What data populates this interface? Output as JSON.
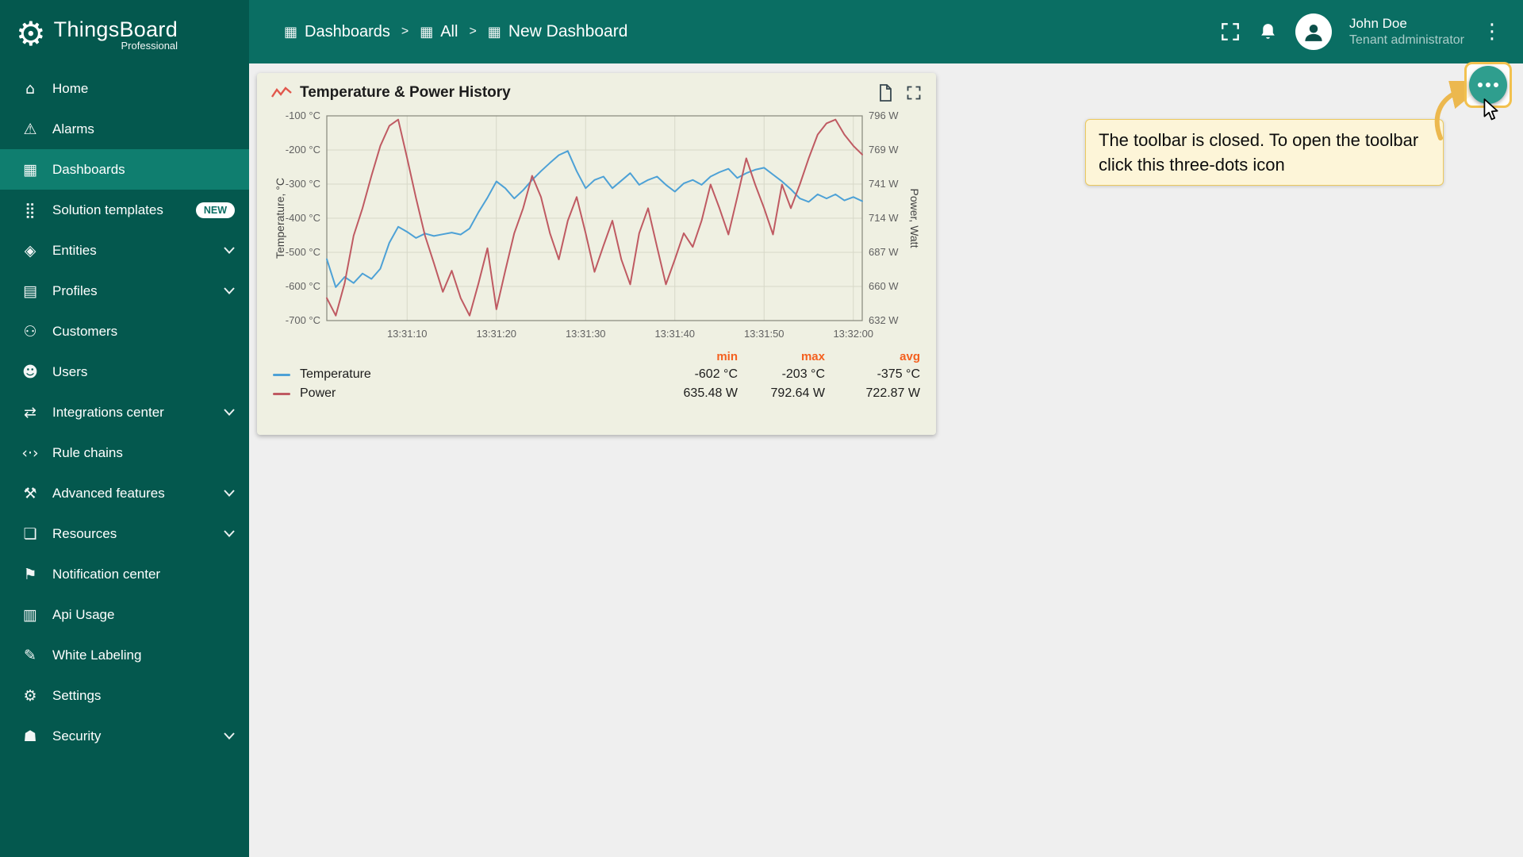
{
  "app": {
    "name": "ThingsBoard",
    "subtitle": "Professional",
    "logo_icon": "⛭"
  },
  "icons": {
    "kebab": "⋮",
    "logo_gear": "⚙"
  },
  "sidebar": {
    "items": [
      {
        "label": "Home",
        "icon": "⌂"
      },
      {
        "label": "Alarms",
        "icon": "⚠"
      },
      {
        "label": "Dashboards",
        "icon": "▦",
        "active": true
      },
      {
        "label": "Solution templates",
        "icon": "⣿",
        "badge": "NEW"
      },
      {
        "label": "Entities",
        "icon": "◈",
        "chevron": true
      },
      {
        "label": "Profiles",
        "icon": "▤",
        "chevron": true
      },
      {
        "label": "Customers",
        "icon": "⚇"
      },
      {
        "label": "Users",
        "icon": "☻"
      },
      {
        "label": "Integrations center",
        "icon": "⇄",
        "chevron": true
      },
      {
        "label": "Rule chains",
        "icon": "‹·›"
      },
      {
        "label": "Advanced features",
        "icon": "⚒",
        "chevron": true
      },
      {
        "label": "Resources",
        "icon": "❏",
        "chevron": true
      },
      {
        "label": "Notification center",
        "icon": "⚑"
      },
      {
        "label": "Api Usage",
        "icon": "▥"
      },
      {
        "label": "White Labeling",
        "icon": "✎"
      },
      {
        "label": "Settings",
        "icon": "⚙"
      },
      {
        "label": "Security",
        "icon": "☗",
        "chevron": true
      }
    ]
  },
  "header": {
    "separator": ">",
    "breadcrumb": [
      {
        "label": "Dashboards",
        "icon": "▦"
      },
      {
        "label": "All",
        "icon": "▦"
      },
      {
        "label": "New Dashboard",
        "icon": "▦"
      }
    ],
    "user": {
      "name": "John Doe",
      "role": "Tenant administrator"
    }
  },
  "widget": {
    "title": "Temperature & Power History",
    "legend": {
      "headers": [
        "min",
        "max",
        "avg"
      ],
      "rows": [
        {
          "label": "Temperature",
          "color": "#4da1d6",
          "min": "-602 °C",
          "max": "-203 °C",
          "avg": "-375 °C"
        },
        {
          "label": "Power",
          "color": "#bf5a62",
          "min": "635.48 W",
          "max": "792.64 W",
          "avg": "722.87 W"
        }
      ]
    }
  },
  "callout": {
    "text": "The toolbar is closed. To open the toolbar click this three-dots icon"
  },
  "colors": {
    "teal_header": "#0a6e63",
    "teal_sidebar": "#04584e",
    "teal_active": "#0f7e6f",
    "fab": "#2f9e8e",
    "highlight": "#f2c14e",
    "legend_header": "#f4601f",
    "card_bg": "#eff0e2"
  },
  "chart_data": {
    "type": "line",
    "title": "Temperature & Power History",
    "x_domain": [
      1,
      61
    ],
    "x_ticks": [
      {
        "t": 10,
        "label": "13:31:10"
      },
      {
        "t": 20,
        "label": "13:31:20"
      },
      {
        "t": 30,
        "label": "13:31:30"
      },
      {
        "t": 40,
        "label": "13:31:40"
      },
      {
        "t": 50,
        "label": "13:31:50"
      },
      {
        "t": 60,
        "label": "13:32:00"
      }
    ],
    "y_left": {
      "label": "Temperature, °C",
      "range": [
        -100,
        -700
      ],
      "ticks": [
        "-100 °C",
        "-200 °C",
        "-300 °C",
        "-400 °C",
        "-500 °C",
        "-600 °C",
        "-700 °C"
      ]
    },
    "y_right": {
      "label": "Power, Watt",
      "range": [
        796,
        632
      ],
      "ticks": [
        "796 W",
        "769 W",
        "741 W",
        "714 W",
        "687 W",
        "660 W",
        "632 W"
      ]
    },
    "legend_position": "bottom",
    "grid": true,
    "series": [
      {
        "name": "Temperature",
        "axis": "left",
        "color": "#4da1d6",
        "stats": {
          "min": -602,
          "max": -203,
          "avg": -375
        },
        "points": [
          [
            1,
            -520
          ],
          [
            2,
            -602
          ],
          [
            3,
            -572
          ],
          [
            4,
            -590
          ],
          [
            5,
            -562
          ],
          [
            6,
            -578
          ],
          [
            7,
            -548
          ],
          [
            8,
            -472
          ],
          [
            9,
            -425
          ],
          [
            10,
            -440
          ],
          [
            11,
            -458
          ],
          [
            12,
            -445
          ],
          [
            13,
            -452
          ],
          [
            14,
            -447
          ],
          [
            15,
            -442
          ],
          [
            16,
            -448
          ],
          [
            17,
            -430
          ],
          [
            18,
            -382
          ],
          [
            19,
            -340
          ],
          [
            20,
            -292
          ],
          [
            21,
            -312
          ],
          [
            22,
            -342
          ],
          [
            23,
            -318
          ],
          [
            24,
            -288
          ],
          [
            25,
            -262
          ],
          [
            26,
            -238
          ],
          [
            27,
            -215
          ],
          [
            28,
            -203
          ],
          [
            29,
            -262
          ],
          [
            30,
            -312
          ],
          [
            31,
            -288
          ],
          [
            32,
            -278
          ],
          [
            33,
            -312
          ],
          [
            34,
            -290
          ],
          [
            35,
            -268
          ],
          [
            36,
            -302
          ],
          [
            37,
            -288
          ],
          [
            38,
            -278
          ],
          [
            39,
            -302
          ],
          [
            40,
            -322
          ],
          [
            41,
            -298
          ],
          [
            42,
            -288
          ],
          [
            43,
            -302
          ],
          [
            44,
            -278
          ],
          [
            45,
            -265
          ],
          [
            46,
            -255
          ],
          [
            47,
            -282
          ],
          [
            48,
            -268
          ],
          [
            49,
            -258
          ],
          [
            50,
            -252
          ],
          [
            51,
            -272
          ],
          [
            52,
            -292
          ],
          [
            53,
            -315
          ],
          [
            54,
            -342
          ],
          [
            55,
            -352
          ],
          [
            56,
            -330
          ],
          [
            57,
            -342
          ],
          [
            58,
            -330
          ],
          [
            59,
            -348
          ],
          [
            60,
            -338
          ],
          [
            61,
            -350
          ]
        ]
      },
      {
        "name": "Power",
        "axis": "right",
        "color": "#bf5a62",
        "stats": {
          "min": 635.48,
          "max": 792.64,
          "avg": 722.87
        },
        "points": [
          [
            1,
            650
          ],
          [
            2,
            636
          ],
          [
            3,
            662
          ],
          [
            4,
            700
          ],
          [
            5,
            722
          ],
          [
            6,
            748
          ],
          [
            7,
            772
          ],
          [
            8,
            788
          ],
          [
            9,
            793
          ],
          [
            10,
            762
          ],
          [
            11,
            730
          ],
          [
            12,
            700
          ],
          [
            13,
            678
          ],
          [
            14,
            655
          ],
          [
            15,
            672
          ],
          [
            16,
            650
          ],
          [
            17,
            636
          ],
          [
            18,
            662
          ],
          [
            19,
            690
          ],
          [
            20,
            641
          ],
          [
            21,
            672
          ],
          [
            22,
            702
          ],
          [
            23,
            722
          ],
          [
            24,
            748
          ],
          [
            25,
            731
          ],
          [
            26,
            702
          ],
          [
            27,
            681
          ],
          [
            28,
            712
          ],
          [
            29,
            731
          ],
          [
            30,
            702
          ],
          [
            31,
            671
          ],
          [
            32,
            692
          ],
          [
            33,
            712
          ],
          [
            34,
            681
          ],
          [
            35,
            661
          ],
          [
            36,
            702
          ],
          [
            37,
            722
          ],
          [
            38,
            691
          ],
          [
            39,
            661
          ],
          [
            40,
            681
          ],
          [
            41,
            702
          ],
          [
            42,
            691
          ],
          [
            43,
            712
          ],
          [
            44,
            741
          ],
          [
            45,
            722
          ],
          [
            46,
            701
          ],
          [
            47,
            731
          ],
          [
            48,
            762
          ],
          [
            49,
            741
          ],
          [
            50,
            722
          ],
          [
            51,
            701
          ],
          [
            52,
            741
          ],
          [
            53,
            722
          ],
          [
            54,
            741
          ],
          [
            55,
            762
          ],
          [
            56,
            781
          ],
          [
            57,
            790
          ],
          [
            58,
            793
          ],
          [
            59,
            781
          ],
          [
            60,
            772
          ],
          [
            61,
            765
          ]
        ]
      }
    ]
  }
}
